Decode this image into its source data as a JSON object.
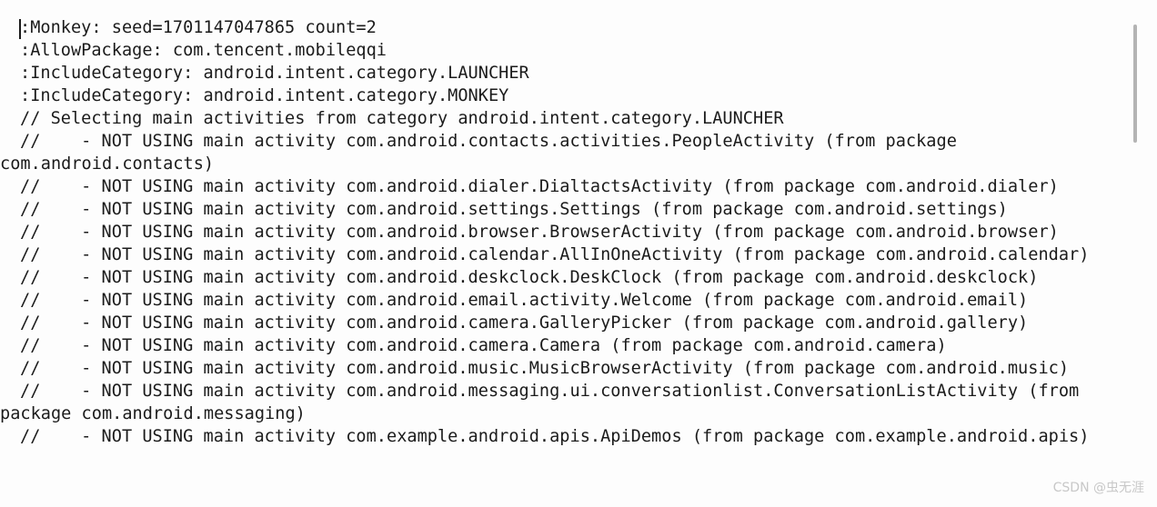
{
  "console": {
    "background_color": "#fdfdfd",
    "text_color": "#1b1b1b",
    "lines": [
      ":Monkey: seed=1701147047865 count=2",
      ":AllowPackage: com.tencent.mobileqqi",
      ":IncludeCategory: android.intent.category.LAUNCHER",
      ":IncludeCategory: android.intent.category.MONKEY",
      "// Selecting main activities from category android.intent.category.LAUNCHER",
      "//    - NOT USING main activity com.android.contacts.activities.PeopleActivity (from package com.android.contacts)",
      "//    - NOT USING main activity com.android.dialer.DialtactsActivity (from package com.android.dialer)",
      "//    - NOT USING main activity com.android.settings.Settings (from package com.android.settings)",
      "//    - NOT USING main activity com.android.browser.BrowserActivity (from package com.android.browser)",
      "//    - NOT USING main activity com.android.calendar.AllInOneActivity (from package com.android.calendar)",
      "//    - NOT USING main activity com.android.deskclock.DeskClock (from package com.android.deskclock)",
      "//    - NOT USING main activity com.android.email.activity.Welcome (from package com.android.email)",
      "//    - NOT USING main activity com.android.camera.GalleryPicker (from package com.android.gallery)",
      "//    - NOT USING main activity com.android.camera.Camera (from package com.android.camera)",
      "//    - NOT USING main activity com.android.music.MusicBrowserActivity (from package com.android.music)",
      "//    - NOT USING main activity com.android.messaging.ui.conversationlist.ConversationListActivity (from package com.android.messaging)",
      "//    - NOT USING main activity com.example.android.apis.ApiDemos (from package com.example.android.apis)"
    ]
  },
  "scrollbar": {
    "thumb_color": "#b4b4b4",
    "orientation": "vertical"
  },
  "caret": {
    "visible": true
  },
  "watermark": {
    "text": "CSDN @虫无涯",
    "color": "#c8c8c8"
  }
}
